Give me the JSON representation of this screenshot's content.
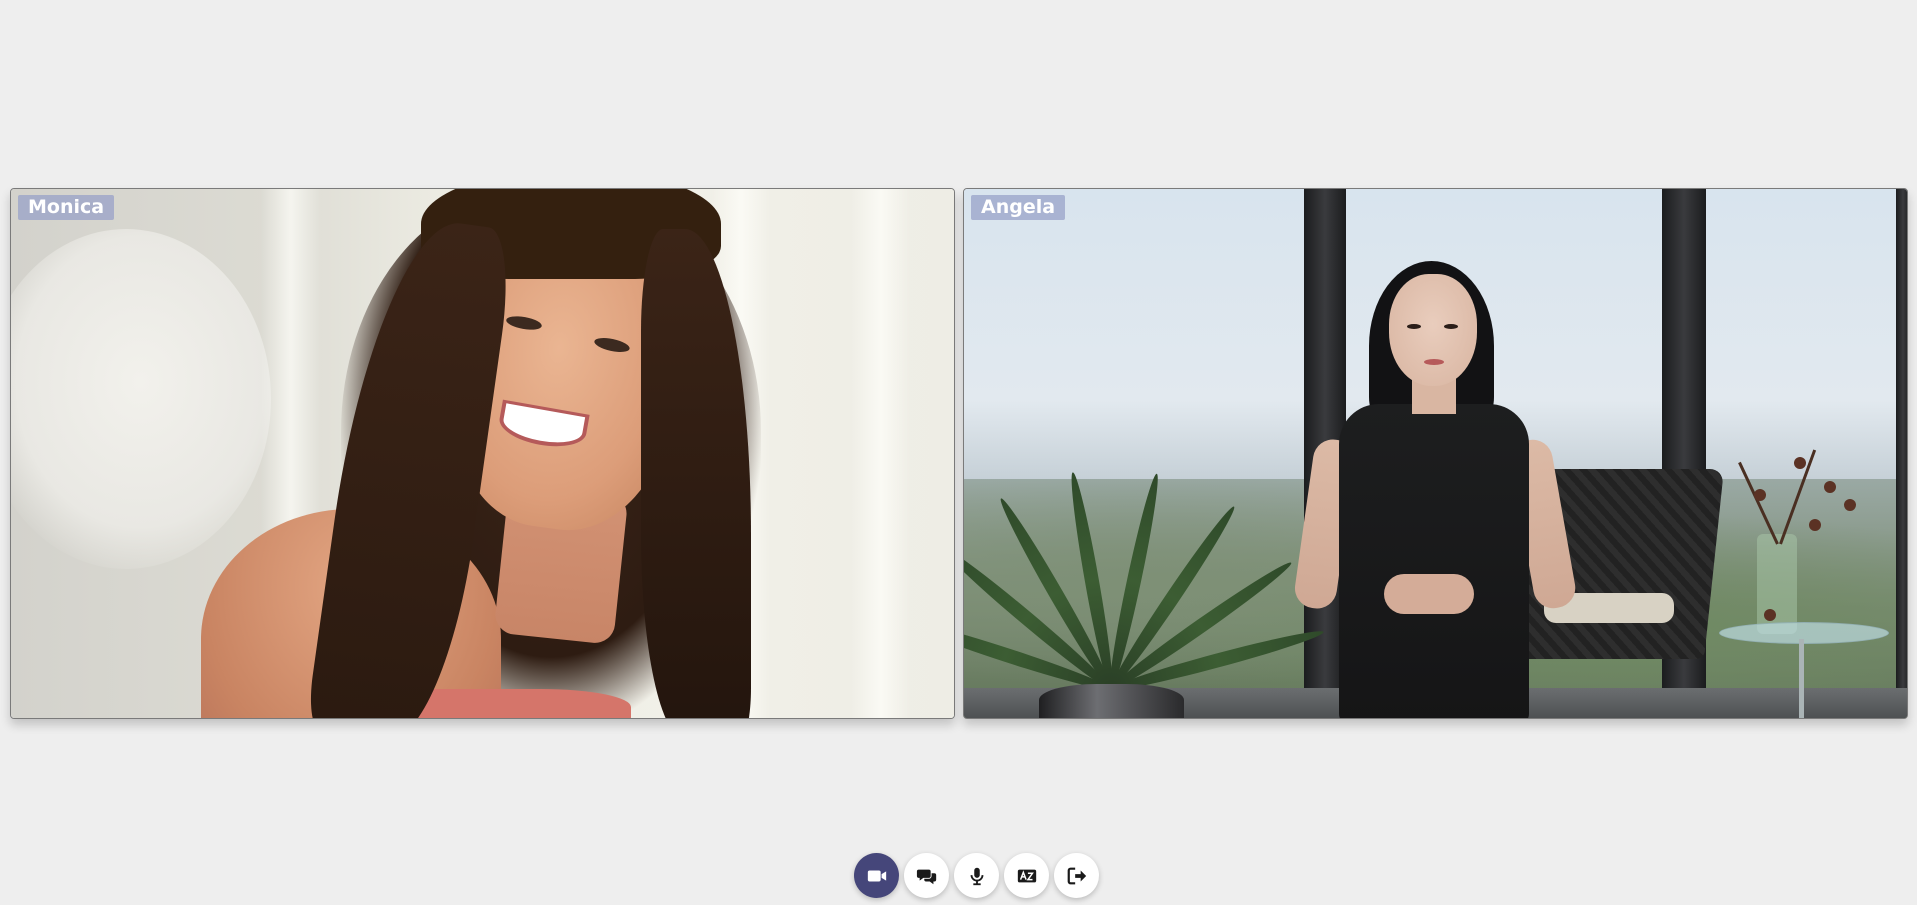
{
  "participants": [
    {
      "name": "Monica"
    },
    {
      "name": "Angela"
    }
  ],
  "controls": {
    "items": [
      {
        "icon": "video-camera-icon",
        "active": true
      },
      {
        "icon": "chat-icon",
        "active": false
      },
      {
        "icon": "microphone-icon",
        "active": false
      },
      {
        "icon": "captions-icon",
        "active": false
      },
      {
        "icon": "leave-icon",
        "active": false
      }
    ],
    "active_color": "#45467a"
  }
}
